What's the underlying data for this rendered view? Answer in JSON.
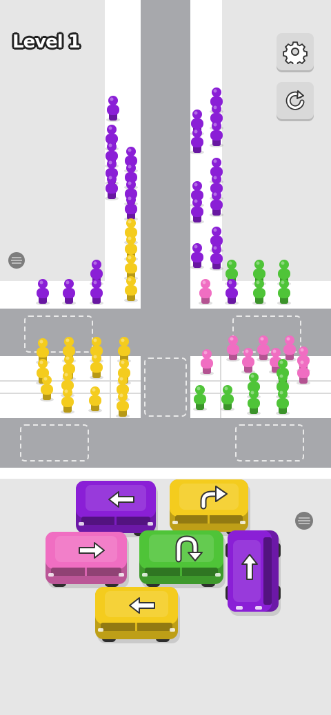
{
  "hud": {
    "level_label": "Level 1",
    "settings_icon": "gear-icon",
    "restart_icon": "restart-icon"
  },
  "colors": {
    "purple": "#8a1fd6",
    "yellow": "#f4cc1e",
    "green": "#4fc438",
    "pink": "#f06ec2",
    "road": "#a7a8ac",
    "sidewalk": "#ffffff",
    "ground": "#e6e6e6"
  },
  "crowds": [
    {
      "color": "purple",
      "count": 24
    },
    {
      "color": "yellow",
      "count": 18
    },
    {
      "color": "green",
      "count": 12
    },
    {
      "color": "pink",
      "count": 10
    }
  ],
  "cars": [
    {
      "id": "car-purple-top",
      "color": "purple",
      "arrow": "left"
    },
    {
      "id": "car-yellow-top",
      "color": "yellow",
      "arrow": "turn-right"
    },
    {
      "id": "car-pink",
      "color": "pink",
      "arrow": "right"
    },
    {
      "id": "car-green",
      "color": "green",
      "arrow": "u-turn"
    },
    {
      "id": "car-purple-right",
      "color": "purple",
      "arrow": "up"
    },
    {
      "id": "car-yellow-bottom",
      "color": "yellow",
      "arrow": "left"
    }
  ]
}
